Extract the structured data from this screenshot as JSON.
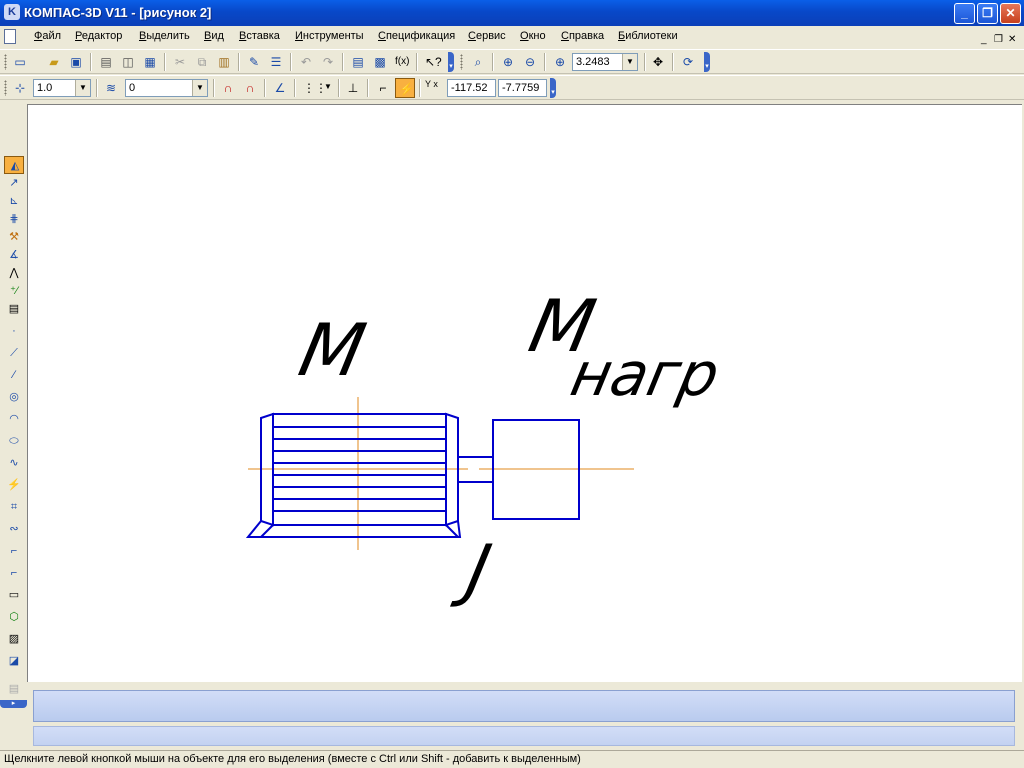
{
  "window": {
    "title": "КОМПАС-3D V11 - [рисунок 2]",
    "logo": "K",
    "minimize": "_",
    "maximize": "❐",
    "close": "✕"
  },
  "menu": {
    "items": [
      "Файл",
      "Редактор",
      "Выделить",
      "Вид",
      "Вставка",
      "Инструменты",
      "Спецификация",
      "Сервис",
      "Окно",
      "Справка",
      "Библиотеки"
    ],
    "mdi_minimize": "_",
    "mdi_restore": "❐",
    "mdi_close": "✕"
  },
  "toolbar": {
    "zoom_value": "3.2483",
    "line_style": "1.0",
    "layer": "0",
    "coord_x": "-117.52",
    "coord_y": "-7.7759",
    "coord_label": "Y x",
    "fx_label": "f(x)"
  },
  "drawing": {
    "label_torque": "М",
    "label_load_m": "М",
    "label_load_sub": "нагр",
    "label_inertia": "J",
    "stroke_color": "#0000cc",
    "axis_color": "#e08a1e",
    "text_color": "#000000"
  },
  "status": {
    "hint": "Щелкните левой кнопкой мыши на объекте для его выделения (вместе с Ctrl или Shift - добавить к выделенным)"
  }
}
